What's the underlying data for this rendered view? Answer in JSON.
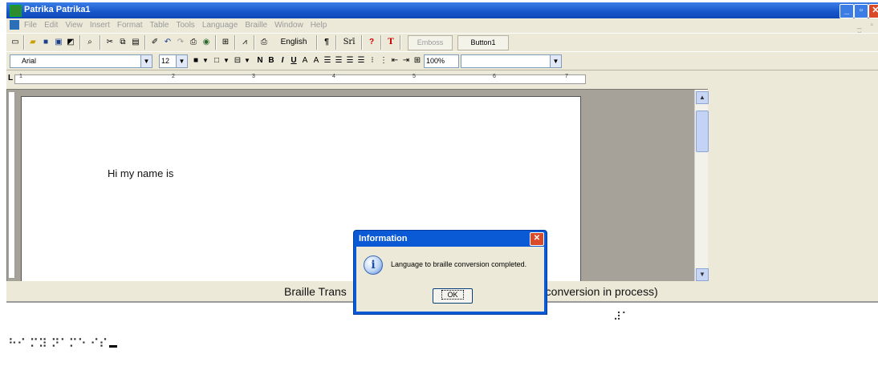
{
  "window": {
    "title": "Patrika  Patrika1",
    "min": "_",
    "max": "▫",
    "close": "✕"
  },
  "menu": {
    "items": [
      "File",
      "Edit",
      "View",
      "Insert",
      "Format",
      "Table",
      "Tools",
      "Language",
      "Braille",
      "Window",
      "Help"
    ],
    "mdi_controls": "_ ▫ ×"
  },
  "toolbar1": {
    "language": "English",
    "pilcrow": "¶",
    "sri": "Srī",
    "help": "?",
    "tamil": "T",
    "emboss": "Emboss",
    "button1": "Button1"
  },
  "toolbar2": {
    "font": "Arial",
    "font_size": "12",
    "zoom": "100%",
    "bold": "N",
    "bold2": "B",
    "italic": "I",
    "underline": "U",
    "superscript": "A",
    "subscript": "A"
  },
  "ruler": {
    "numbers": [
      "1",
      "2",
      "3",
      "4",
      "5",
      "6",
      "7"
    ]
  },
  "editor": {
    "text": "Hi my name is"
  },
  "braille_label": {
    "left": "Braille Trans",
    "right": "e conversion in process)"
  },
  "braille_output": {
    "line1": "⠼⠁",
    "line2": "⠓⠊ ⠍⠽ ⠝⠁⠍⠑ ⠊⠎"
  },
  "dialog": {
    "title": "Information",
    "message": "Language to braille conversion completed.",
    "ok": "OK",
    "close": "✕",
    "icon": "i"
  }
}
